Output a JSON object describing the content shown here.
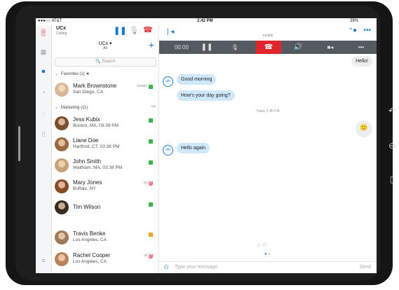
{
  "status_bar": {
    "carrier": "●●●○○ AT&T",
    "time": "2:42 PM",
    "battery": "39%"
  },
  "call": {
    "name": "UCx",
    "state": "Calling",
    "timer": "00:00",
    "device": "mobile"
  },
  "list_header": {
    "title": "UCx ▾",
    "filter": "All"
  },
  "search": {
    "placeholder": "Search"
  },
  "favorites": {
    "label": "Favorites (1) ★",
    "contacts": [
      {
        "name": "Mark Brownstone",
        "location": "San Diego, CA",
        "meta": "mobile",
        "status": "green"
      }
    ]
  },
  "marketing": {
    "label": "Marketing (11)",
    "more": "•••",
    "contacts": [
      {
        "name": "Jess Kubix",
        "location": "Boston, MA, 03:39 PM",
        "meta": "",
        "status": "green"
      },
      {
        "name": "Liane Doe",
        "location": "Hartford, CT, 03:38 PM",
        "meta": "",
        "status": "green"
      },
      {
        "name": "John Smith",
        "location": "Waltham, MA, 03:38 PM",
        "meta": "",
        "status": "green"
      },
      {
        "name": "Mary Jones",
        "location": "Buffalo, NY",
        "meta": "ng",
        "status": "red"
      },
      {
        "name": "Tim Wilson",
        "location": "",
        "meta": "",
        "status": "green"
      },
      {
        "name": "Travis Benke",
        "location": "Los Angeles, CA",
        "meta": "",
        "status": "orange"
      },
      {
        "name": "Rachel Cooper",
        "location": "Los Angeles, CA",
        "meta": "all",
        "status": "red"
      }
    ]
  },
  "chat": {
    "messages_in_1": [
      "Good morning",
      "How's your day going?"
    ],
    "out_first": "Hello!",
    "timestamp": "Today 1:45 PM",
    "out_emoji": "🙂",
    "messages_in_2": [
      "Hello again"
    ],
    "avatar_initials": "um",
    "composer_placeholder": "Type your message",
    "send_label": "Send"
  },
  "colors": {
    "accent": "#1b7ad0",
    "hangup": "#e0252b",
    "green": "#3cb54a",
    "orange": "#f5a623",
    "red": "#e0252b"
  }
}
